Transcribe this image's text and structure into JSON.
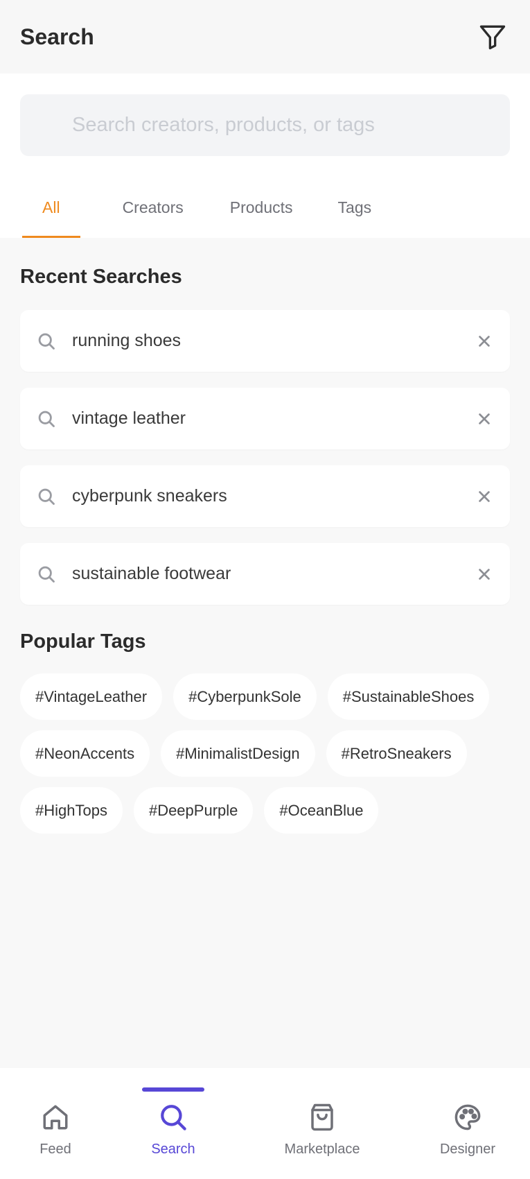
{
  "header": {
    "title": "Search"
  },
  "search": {
    "placeholder": "Search creators, products, or tags",
    "value": ""
  },
  "tabs": [
    {
      "label": "All",
      "active": true
    },
    {
      "label": "Creators",
      "active": false
    },
    {
      "label": "Products",
      "active": false
    },
    {
      "label": "Tags",
      "active": false
    }
  ],
  "recent": {
    "title": "Recent Searches",
    "items": [
      {
        "text": "running shoes"
      },
      {
        "text": "vintage leather"
      },
      {
        "text": "cyberpunk sneakers"
      },
      {
        "text": "sustainable footwear"
      }
    ]
  },
  "popular": {
    "title": "Popular Tags",
    "tags": [
      "#VintageLeather",
      "#CyberpunkSole",
      "#SustainableShoes",
      "#NeonAccents",
      "#MinimalistDesign",
      "#RetroSneakers",
      "#HighTops",
      "#DeepPurple",
      "#OceanBlue"
    ]
  },
  "nav": {
    "items": [
      {
        "label": "Feed",
        "icon": "home-icon",
        "active": false
      },
      {
        "label": "Search",
        "icon": "search-icon",
        "active": true
      },
      {
        "label": "Marketplace",
        "icon": "shopping-bag-icon",
        "active": false
      },
      {
        "label": "Designer",
        "icon": "palette-icon",
        "active": false
      }
    ]
  },
  "colors": {
    "accent_tab": "#ef8a1e",
    "accent_nav": "#5747d6",
    "background": "#f8f8f8",
    "card": "#ffffff"
  }
}
